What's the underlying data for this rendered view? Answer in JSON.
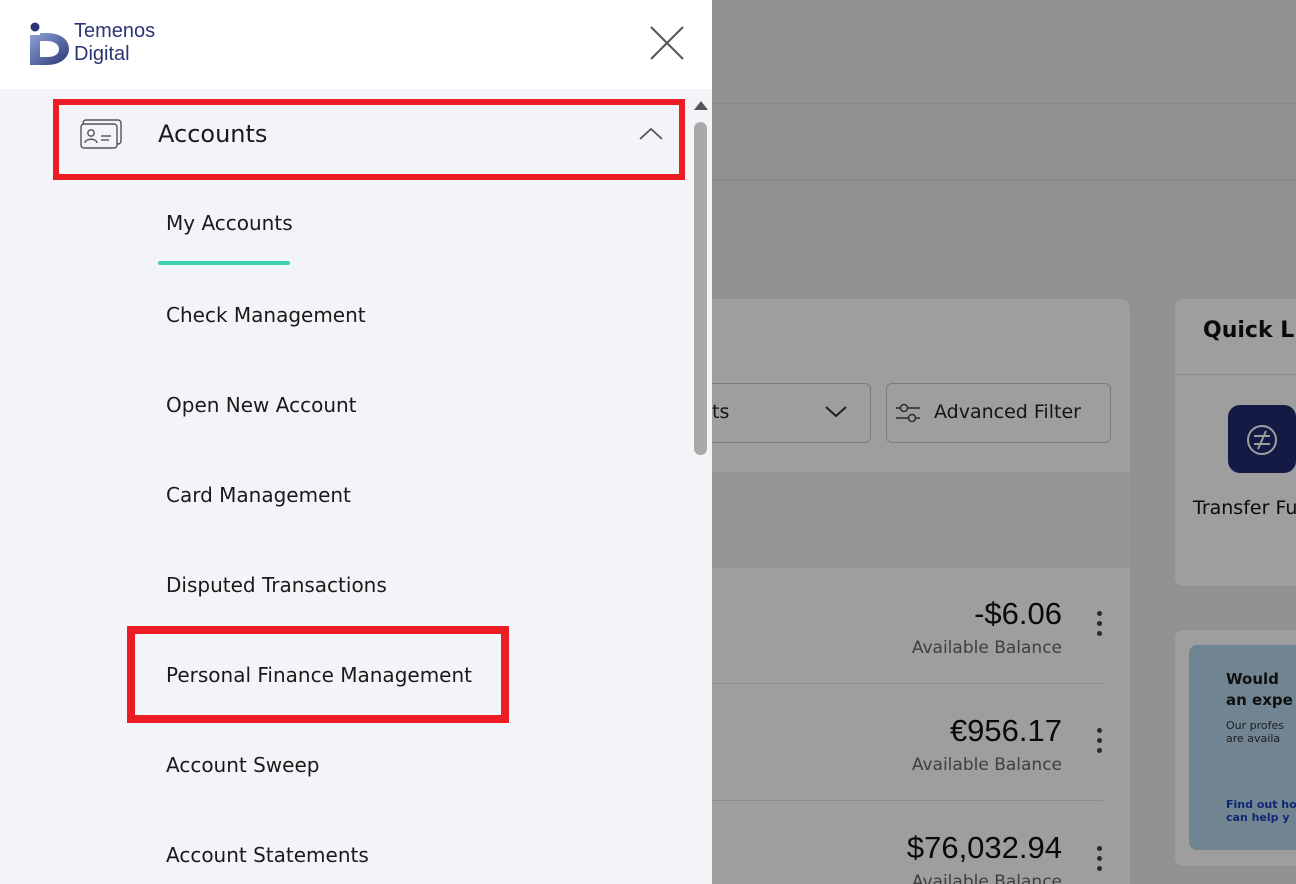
{
  "drawer": {
    "logo": {
      "line1": "Temenos",
      "line2": "Digital"
    },
    "close_icon": "close-icon",
    "section": {
      "label": "Accounts",
      "icon": "account-card-icon",
      "expanded": true
    },
    "sub_items": [
      {
        "label": "My Accounts",
        "active": true
      },
      {
        "label": "Check Management"
      },
      {
        "label": "Open New Account"
      },
      {
        "label": "Card Management"
      },
      {
        "label": "Disputed Transactions"
      },
      {
        "label": "Personal Finance Management",
        "highlighted": true
      },
      {
        "label": "Account Sweep"
      },
      {
        "label": "Account Statements"
      }
    ],
    "accent_color": "#3dd0ae",
    "highlight_color": "#ec1c24"
  },
  "background": {
    "filter_dropdown_partial": "nts",
    "advanced_filter_label": "Advanced Filter",
    "accounts": [
      {
        "amount": "-$6.06",
        "label": "Available Balance"
      },
      {
        "amount": "€956.17",
        "label": "Available Balance"
      },
      {
        "amount": "$76,032.94",
        "label": "Available Balance"
      }
    ],
    "quick_links": {
      "title_partial": "Quick Li",
      "item_partial": "Transfer Fu",
      "icon": "transfer-icon",
      "icon_bg": "#1f2a6e"
    },
    "promo": {
      "heading_line1": "Would",
      "heading_line2": "an expe",
      "text_line1": "Our profes",
      "text_line2": "are availa",
      "link_line1": "Find out ho",
      "link_line2": "can help y"
    }
  }
}
